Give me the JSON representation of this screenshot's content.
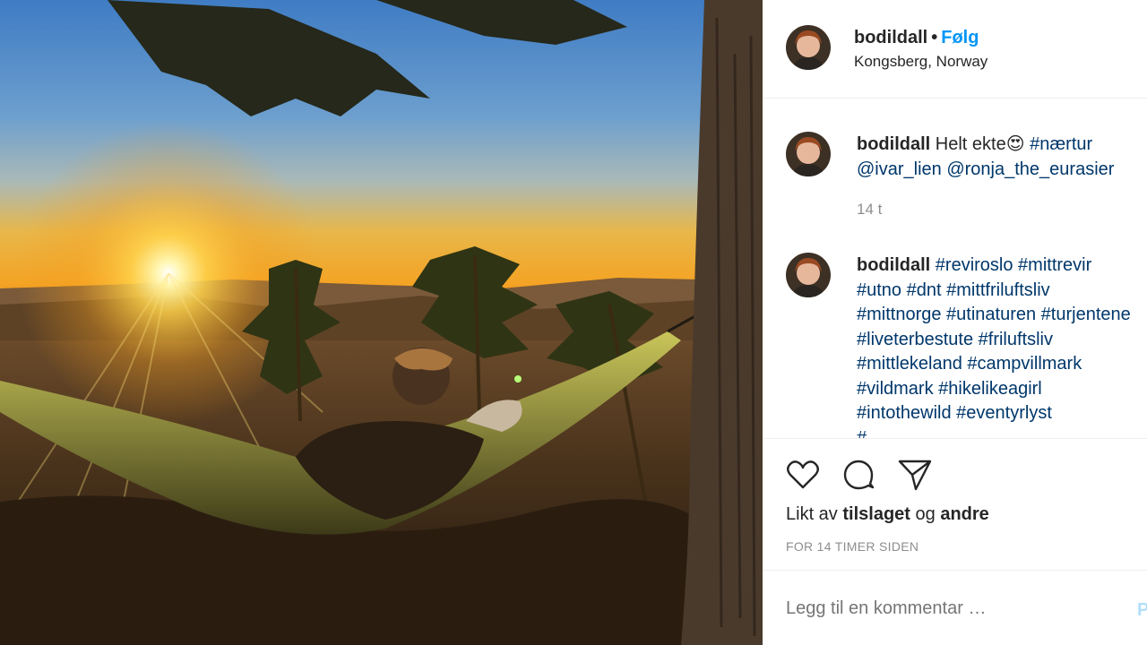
{
  "header": {
    "username": "bodildall",
    "separator": "•",
    "follow_label": "Følg",
    "location": "Kongsberg, Norway"
  },
  "caption": {
    "username": "bodildall",
    "text": "Helt ekte",
    "emoji": "😍",
    "hashtag": "#nærtur",
    "mentions": "@ivar_lien @ronja_the_eurasier",
    "time": "14 t"
  },
  "comment2": {
    "username": "bodildall",
    "lines": [
      "#reviroslo #mittrevir",
      "#utno #dnt #mittfriluftsliv",
      "#mittnorge #utinaturen #turjentene",
      "#liveterbestute #friluftsliv",
      "#mittlekeland #campvillmark",
      "#vildmark #hikelikeagirl",
      "#intothewild #eventyrlyst",
      "#..."
    ]
  },
  "actions": {
    "icons": [
      "heart-icon",
      "comment-icon",
      "share-icon"
    ],
    "likes_prefix": "Likt av",
    "likes_user": "tilslaget",
    "likes_and": "og",
    "likes_others": "andre",
    "timestamp": "FOR 14 TIMER SIDEN"
  },
  "comment_box": {
    "placeholder": "Legg til en kommentar …",
    "post_label": "P"
  },
  "colors": {
    "accent": "#0095f6",
    "link": "#00376b",
    "muted": "#8e8e8e"
  }
}
